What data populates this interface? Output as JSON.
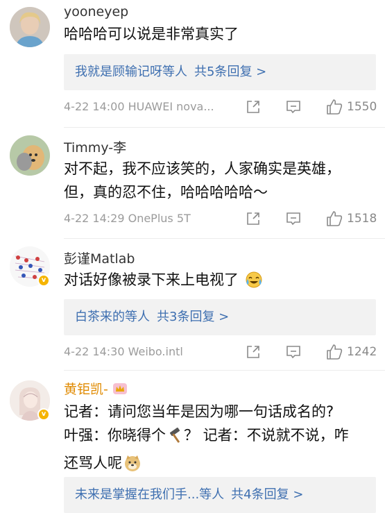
{
  "comments": [
    {
      "username": "yooneyep",
      "lines": [
        "哈哈哈可以说是非常真实了"
      ],
      "reply_who": "我就是顾输记呀等人",
      "reply_more": "共5条回复 >",
      "time": "4-22 14:00 HUAWEI nova...",
      "likes": "1550"
    },
    {
      "username": "Timmy-李",
      "lines": [
        "对不起，我不应该笑的，人家确实是英雄，",
        "但，真的忍不住，哈哈哈哈哈～"
      ],
      "time": "4-22 14:29 OnePlus 5T",
      "likes": "1518"
    },
    {
      "username": "彭谨Matlab",
      "lines": [
        "对话好像被录下来上电视了"
      ],
      "reply_who": "白茶来的等人",
      "reply_more": "共3条回复 >",
      "time": "4-22 14:30 Weibo.intl",
      "likes": "1242"
    },
    {
      "username": "黄钜凯-",
      "lines": [
        "记者：请问您当年是因为哪一句话成名的?",
        "叶强：你晓得个",
        "？ 记者：不说就不说，咋",
        "还骂人呢"
      ],
      "reply_who": "未来是掌握在我们手...等人",
      "reply_more": "共4条回复 >"
    }
  ],
  "colors": {
    "link": "#3e6fb0",
    "meta": "#9b9b9b",
    "reply_bg": "#f2f2f2",
    "gold_name": "#e08a00"
  },
  "icons": [
    "share-icon",
    "comment-icon",
    "thumbs-up-icon",
    "verified-badge-icon",
    "crying-laugh-emoji",
    "hammer-emoji",
    "doge-emoji",
    "crown-emoji"
  ]
}
